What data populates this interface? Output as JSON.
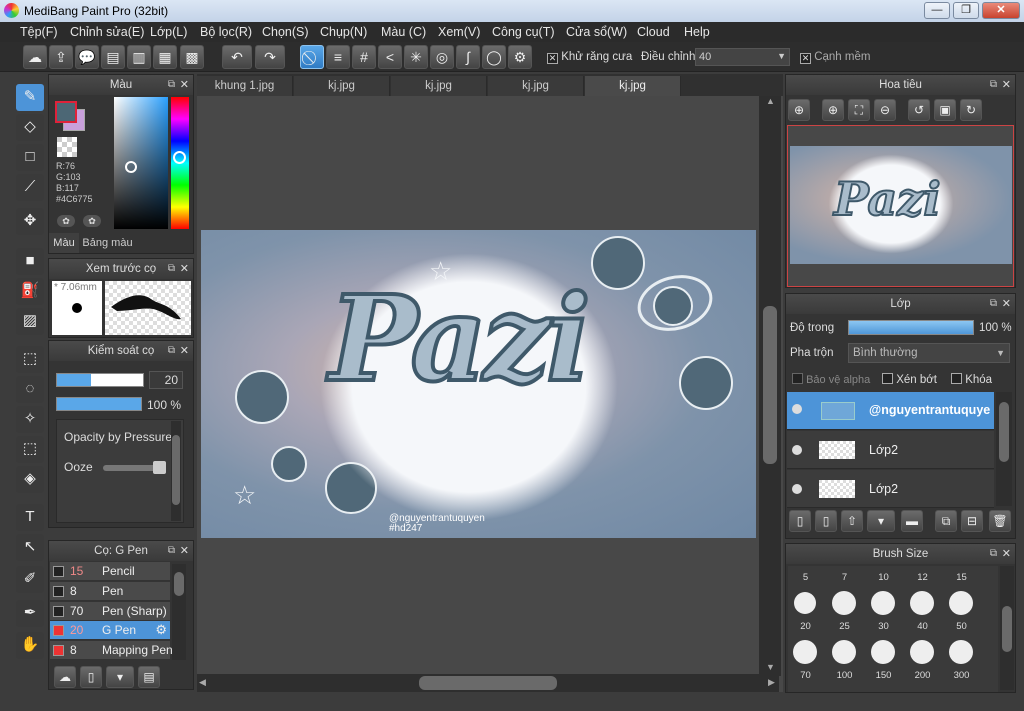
{
  "window": {
    "title": "MediBang Paint Pro (32bit)",
    "min": "—",
    "max": "❐",
    "close": "✕"
  },
  "menu": [
    "Tệp(F)",
    "Chỉnh sửa(E)",
    "Lớp(L)",
    "Bộ lọc(R)",
    "Chọn(S)",
    "Chụp(N)",
    "Màu (C)",
    "Xem(V)",
    "Công cụ(T)",
    "Cửa sổ(W)",
    "Cloud",
    "Help"
  ],
  "toolbar": {
    "antialias_label": "Khử răng cưa",
    "adjust_label": "Điều chỉnh",
    "adjust_value": "40",
    "edge_label": "Cạnh mềm",
    "check": "✕"
  },
  "color_panel": {
    "title": "Màu",
    "r": "R:76",
    "g": "G:103",
    "b": "B:117",
    "hex": "#4C6775",
    "tab_color": "Màu",
    "tab_palette": "Bảng màu",
    "primary": "#4C6775",
    "secondary": "#c9a0dc"
  },
  "brush_preview": {
    "title": "Xem trước cọ",
    "size": "* 7.06mm"
  },
  "brush_control": {
    "title": "Kiểm soát cọ",
    "size_value": "20",
    "opacity_value": "100 %",
    "opacity_pressure": "Opacity by Pressure",
    "ooze": "Ooze"
  },
  "brush_list": {
    "title": "Cọ: G Pen",
    "items": [
      {
        "num": "15",
        "name": "Pencil"
      },
      {
        "num": "8",
        "name": "Pen"
      },
      {
        "num": "70",
        "name": "Pen (Sharp)"
      },
      {
        "num": "20",
        "name": "G Pen"
      },
      {
        "num": "8",
        "name": "Mapping Pen"
      }
    ]
  },
  "doc_tabs": [
    "khung 1.jpg",
    "kj.jpg",
    "kj.jpg",
    "kj.jpg",
    "kj.jpg"
  ],
  "artwork": {
    "text": "Pazi",
    "credit": "@nguyentrantuquyen",
    "tag": "#hd247"
  },
  "navigator": {
    "title": "Hoa tiêu"
  },
  "layers": {
    "title": "Lớp",
    "opacity_label": "Độ trong",
    "opacity_value": "100 %",
    "blend_label": "Pha trộn",
    "blend_value": "Bình thường",
    "protect_alpha": "Bảo vệ alpha",
    "clipping": "Xén bớt",
    "lock": "Khóa",
    "items": [
      {
        "name": "@nguyentrantuquyen"
      },
      {
        "name": "Lớp2"
      },
      {
        "name": "Lớp2"
      }
    ]
  },
  "brush_size": {
    "title": "Brush Size",
    "labels": [
      "5",
      "7",
      "10",
      "12",
      "15",
      "20",
      "25",
      "30",
      "40",
      "50",
      "70",
      "100",
      "150",
      "200",
      "300"
    ]
  }
}
